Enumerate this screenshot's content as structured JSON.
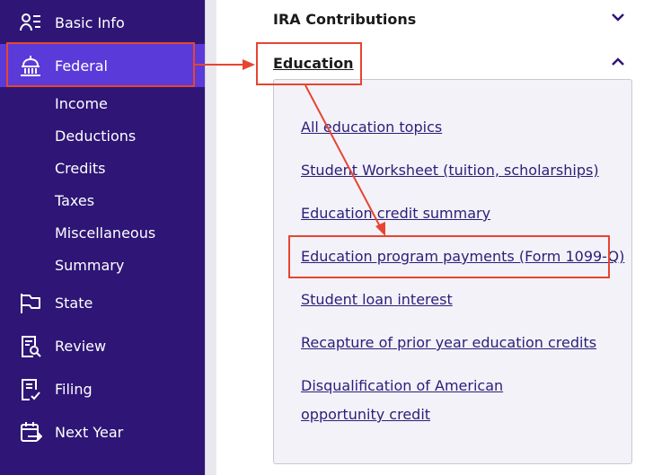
{
  "sidebar": {
    "items": [
      {
        "label": "Basic Info",
        "icon": "user-list-icon"
      },
      {
        "label": "Federal",
        "icon": "capitol-building-icon"
      },
      {
        "label": "State",
        "icon": "flag-icon"
      },
      {
        "label": "Review",
        "icon": "document-search-icon"
      },
      {
        "label": "Filing",
        "icon": "document-check-icon"
      },
      {
        "label": "Next Year",
        "icon": "calendar-arrow-icon"
      }
    ],
    "federal_subitems": [
      "Income",
      "Deductions",
      "Credits",
      "Taxes",
      "Miscellaneous",
      "Summary"
    ]
  },
  "main": {
    "sections": [
      {
        "title": "IRA Contributions",
        "expanded": false
      },
      {
        "title": "Education",
        "expanded": true
      }
    ],
    "education_links": [
      "All education topics",
      "Student Worksheet (tuition, scholarships)",
      "Education credit summary",
      "Education program payments (Form 1099-Q)",
      "Student loan interest",
      "Recapture of prior year education credits",
      "Disqualification of American opportunity credit"
    ]
  },
  "colors": {
    "sidebar_bg": "#2e1576",
    "active_bg": "#5a3ad8",
    "annotation": "#e64531",
    "link": "#2a1f7a"
  }
}
